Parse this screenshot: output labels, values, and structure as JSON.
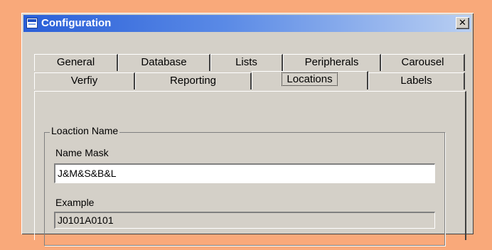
{
  "window": {
    "title": "Configuration",
    "close_glyph": "✕"
  },
  "tabs": {
    "row_top": [
      "General",
      "Database",
      "Lists",
      "Peripherals",
      "Carousel"
    ],
    "row_bottom": [
      "Verfiy",
      "Reporting",
      "Locations",
      "Labels"
    ],
    "active": "Locations"
  },
  "group": {
    "legend": "Loaction Name",
    "name_mask_label": "Name Mask",
    "name_mask_value": "J&M&S&B&L",
    "example_label": "Example",
    "example_value": "J0101A0101"
  },
  "colors": {
    "background": "#f9a97a",
    "title_start": "#2a5fd8",
    "title_end": "#b9cff2",
    "face": "#d4d0c8"
  }
}
